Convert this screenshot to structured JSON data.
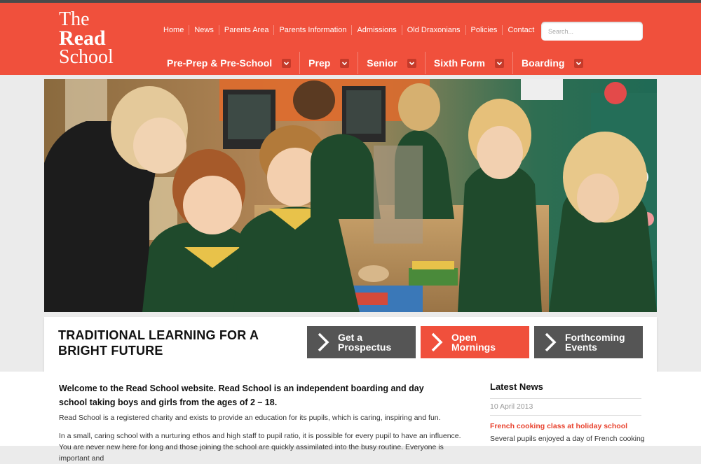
{
  "colors": {
    "brand_red": "#f0503c",
    "dark_grey": "#555555",
    "caret_red": "#c53a2a"
  },
  "logo": {
    "line1": "The",
    "line2": "Read",
    "line3": "School"
  },
  "top_nav": [
    "Home",
    "News",
    "Parents Area",
    "Parents Information",
    "Admissions",
    "Old Draxonians",
    "Policies",
    "Contact"
  ],
  "search": {
    "placeholder": "Search..."
  },
  "main_nav": [
    "Pre-Prep & Pre-School",
    "Prep",
    "Senior",
    "Sixth Form",
    "Boarding"
  ],
  "hero": {
    "icon": "photo-classroom-children"
  },
  "tagline": "TRADITIONAL LEARNING FOR A BRIGHT FUTURE",
  "cta": [
    {
      "line1": "Get a",
      "line2": "Prospectus",
      "icon": "chevron-right-icon"
    },
    {
      "line1": "Open",
      "line2": "Mornings",
      "icon": "chevron-right-icon"
    },
    {
      "line1": "Forthcoming",
      "line2": "Events",
      "icon": "chevron-right-icon"
    }
  ],
  "content": {
    "intro": "Welcome to the Read School website. Read School is an independent boarding and day school taking boys and girls from the ages of 2 – 18.",
    "p1": "Read School is a registered charity and exists to provide an education for its pupils, which is caring, inspiring and fun.",
    "p2": "In a small, caring school with a nurturing ethos and high staff to pupil ratio, it is possible for every pupil to have an influence.  You are never new here for long and those joining the school are quickly assimilated into the busy routine. Everyone is important and"
  },
  "news": {
    "heading": "Latest News",
    "date": "10 April 2013",
    "title": "French cooking class at holiday school",
    "text": "Several pupils enjoyed a day of French cooking"
  }
}
